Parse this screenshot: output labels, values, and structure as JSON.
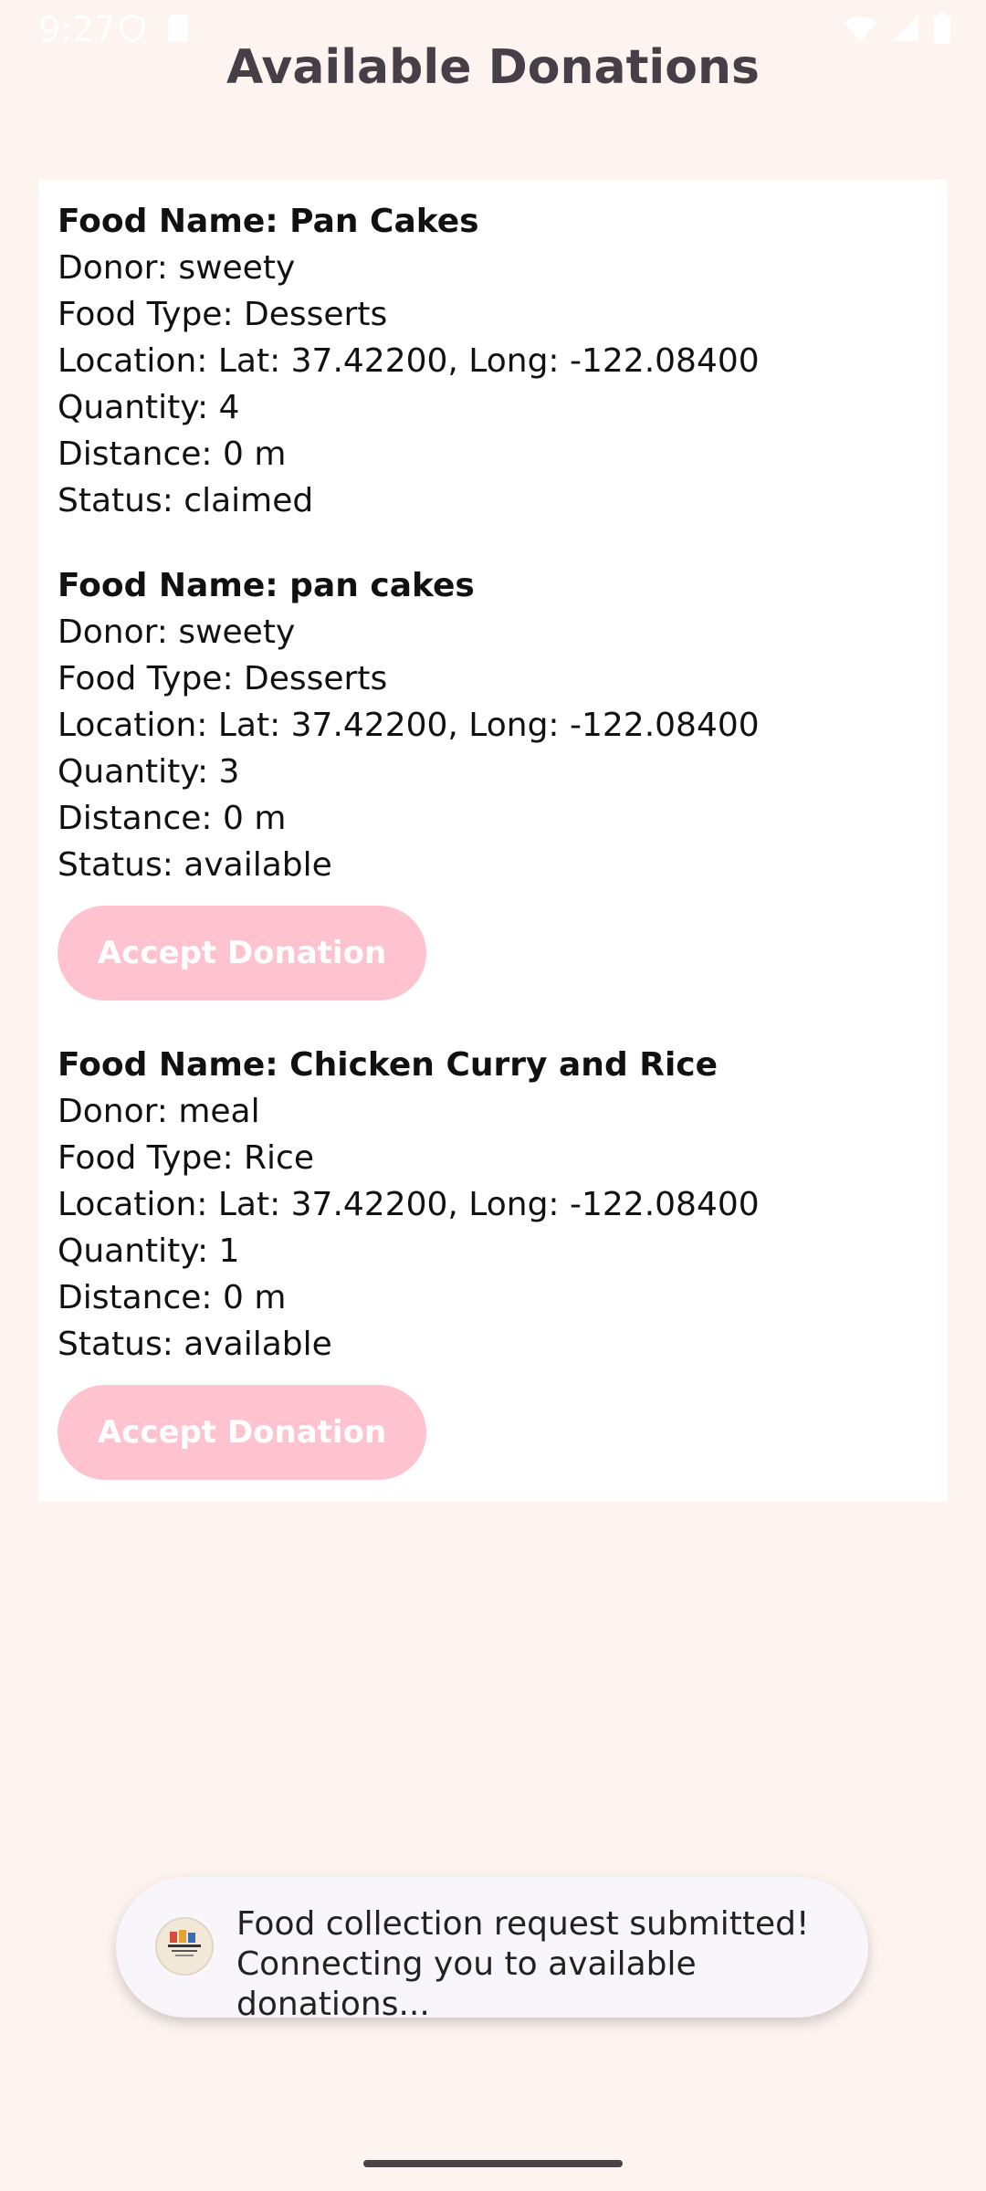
{
  "status_bar": {
    "time": "9:27",
    "left_icons": [
      "shield-phone-icon",
      "sd-card-icon"
    ],
    "right_icons": [
      "wifi-icon",
      "signal-icon",
      "battery-icon"
    ]
  },
  "title": "Available Donations",
  "donations": [
    {
      "food_name": "Food Name: Pan Cakes",
      "donor": "Donor: sweety",
      "food_type": "Food Type: Desserts",
      "location": "Location: Lat: 37.42200, Long: -122.08400",
      "quantity": "Quantity: 4",
      "distance": "Distance: 0 m",
      "status": "Status: claimed"
    },
    {
      "food_name": "Food Name: pan cakes",
      "donor": "Donor: sweety",
      "food_type": "Food Type: Desserts",
      "location": "Location: Lat: 37.42200, Long: -122.08400",
      "quantity": "Quantity: 3",
      "distance": "Distance: 0 m",
      "status": "Status: available",
      "button_label": "Accept Donation"
    },
    {
      "food_name": "Food Name: Chicken Curry and Rice",
      "donor": "Donor: meal",
      "food_type": "Food Type: Rice",
      "location": "Location: Lat: 37.42200, Long: -122.08400",
      "quantity": "Quantity: 1",
      "distance": "Distance: 0 m",
      "status": "Status: available",
      "button_label": "Accept Donation"
    }
  ],
  "toast": {
    "icon": "meal-bridge-logo-icon",
    "line1": "Food collection request submitted!",
    "line2": "Connecting you to available donations..."
  },
  "colors": {
    "background": "#fdf3ef",
    "card": "#ffffff",
    "button": "#fec3ce",
    "title": "#463f48"
  }
}
